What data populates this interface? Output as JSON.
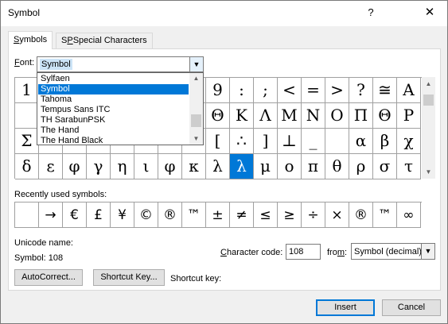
{
  "window": {
    "title": "Symbol",
    "help_glyph": "?",
    "close_glyph": "✕"
  },
  "tabs": [
    {
      "label_u": "S",
      "label_rest": "ymbols"
    },
    {
      "label_u": "P",
      "label_rest": "Special Characters",
      "label_pre": "S"
    }
  ],
  "font": {
    "label_u": "F",
    "label_rest": "ont:",
    "value": "Symbol",
    "options": [
      "Sylfaen",
      "Symbol",
      "Tahoma",
      "Tempus Sans ITC",
      "TH SarabunPSK",
      "The Hand",
      "The Hand Black"
    ],
    "selected_index": 1
  },
  "grid": {
    "rows": [
      [
        "1",
        "",
        "",
        "",
        "",
        "",
        "",
        "",
        "9",
        ":",
        ";",
        "<",
        "=",
        ">",
        "?",
        "≅",
        "Α"
      ],
      [
        "",
        "",
        "",
        "",
        "",
        "",
        "",
        "",
        "Θ",
        "Κ",
        "Λ",
        "Μ",
        "Ν",
        "Ο",
        "Π",
        "Θ",
        "Ρ"
      ],
      [
        "Σ",
        "",
        "",
        "",
        "",
        "",
        "",
        "",
        "[",
        "∴",
        "]",
        "⊥",
        "_",
        "",
        "α",
        "β",
        "χ"
      ],
      [
        "δ",
        "ε",
        "φ",
        "γ",
        "η",
        "ι",
        "φ",
        "κ",
        "λ",
        "λ",
        "μ",
        "ο",
        "π",
        "θ",
        "ρ",
        "σ",
        "τ"
      ]
    ],
    "selected": {
      "row": 3,
      "col": 9
    }
  },
  "recent": {
    "label": "Recently used symbols:",
    "symbols": [
      "",
      "→",
      "€",
      "£",
      "¥",
      "©",
      "®",
      "™",
      "±",
      "≠",
      "≤",
      "≥",
      "÷",
      "×",
      "®",
      "™",
      "∞"
    ]
  },
  "unicode": {
    "label": "Unicode name:",
    "value": "Symbol: 108"
  },
  "char_code": {
    "label_pre": "",
    "label_u": "C",
    "label_rest": "haracter code:",
    "value": "108"
  },
  "from": {
    "label_u": "m",
    "label_pre": "fro",
    "label_rest": ":",
    "value": "Symbol (decimal)"
  },
  "buttons": {
    "autocorrect": "AutoCorrect...",
    "shortcut_key": "Shortcut Key...",
    "insert": "Insert",
    "cancel": "Cancel"
  },
  "shortcut_label": "Shortcut key:"
}
